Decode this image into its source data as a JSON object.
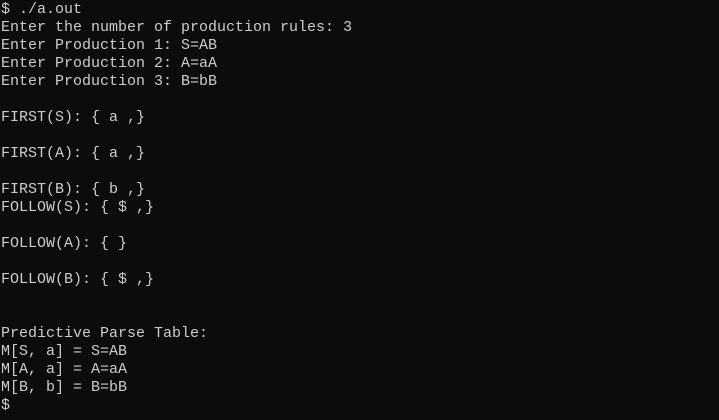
{
  "terminal": {
    "lines": [
      "$ ./a.out",
      "Enter the number of production rules: 3",
      "Enter Production 1: S=AB",
      "Enter Production 2: A=aA",
      "Enter Production 3: B=bB",
      "",
      "FIRST(S): { a ,}",
      "",
      "FIRST(A): { a ,}",
      "",
      "FIRST(B): { b ,}",
      "FOLLOW(S): { $ ,}",
      "",
      "FOLLOW(A): { }",
      "",
      "FOLLOW(B): { $ ,}",
      "",
      "",
      "Predictive Parse Table:",
      "M[S, a] = S=AB",
      "M[A, a] = A=aA",
      "M[B, b] = B=bB"
    ],
    "prompt": "$"
  }
}
